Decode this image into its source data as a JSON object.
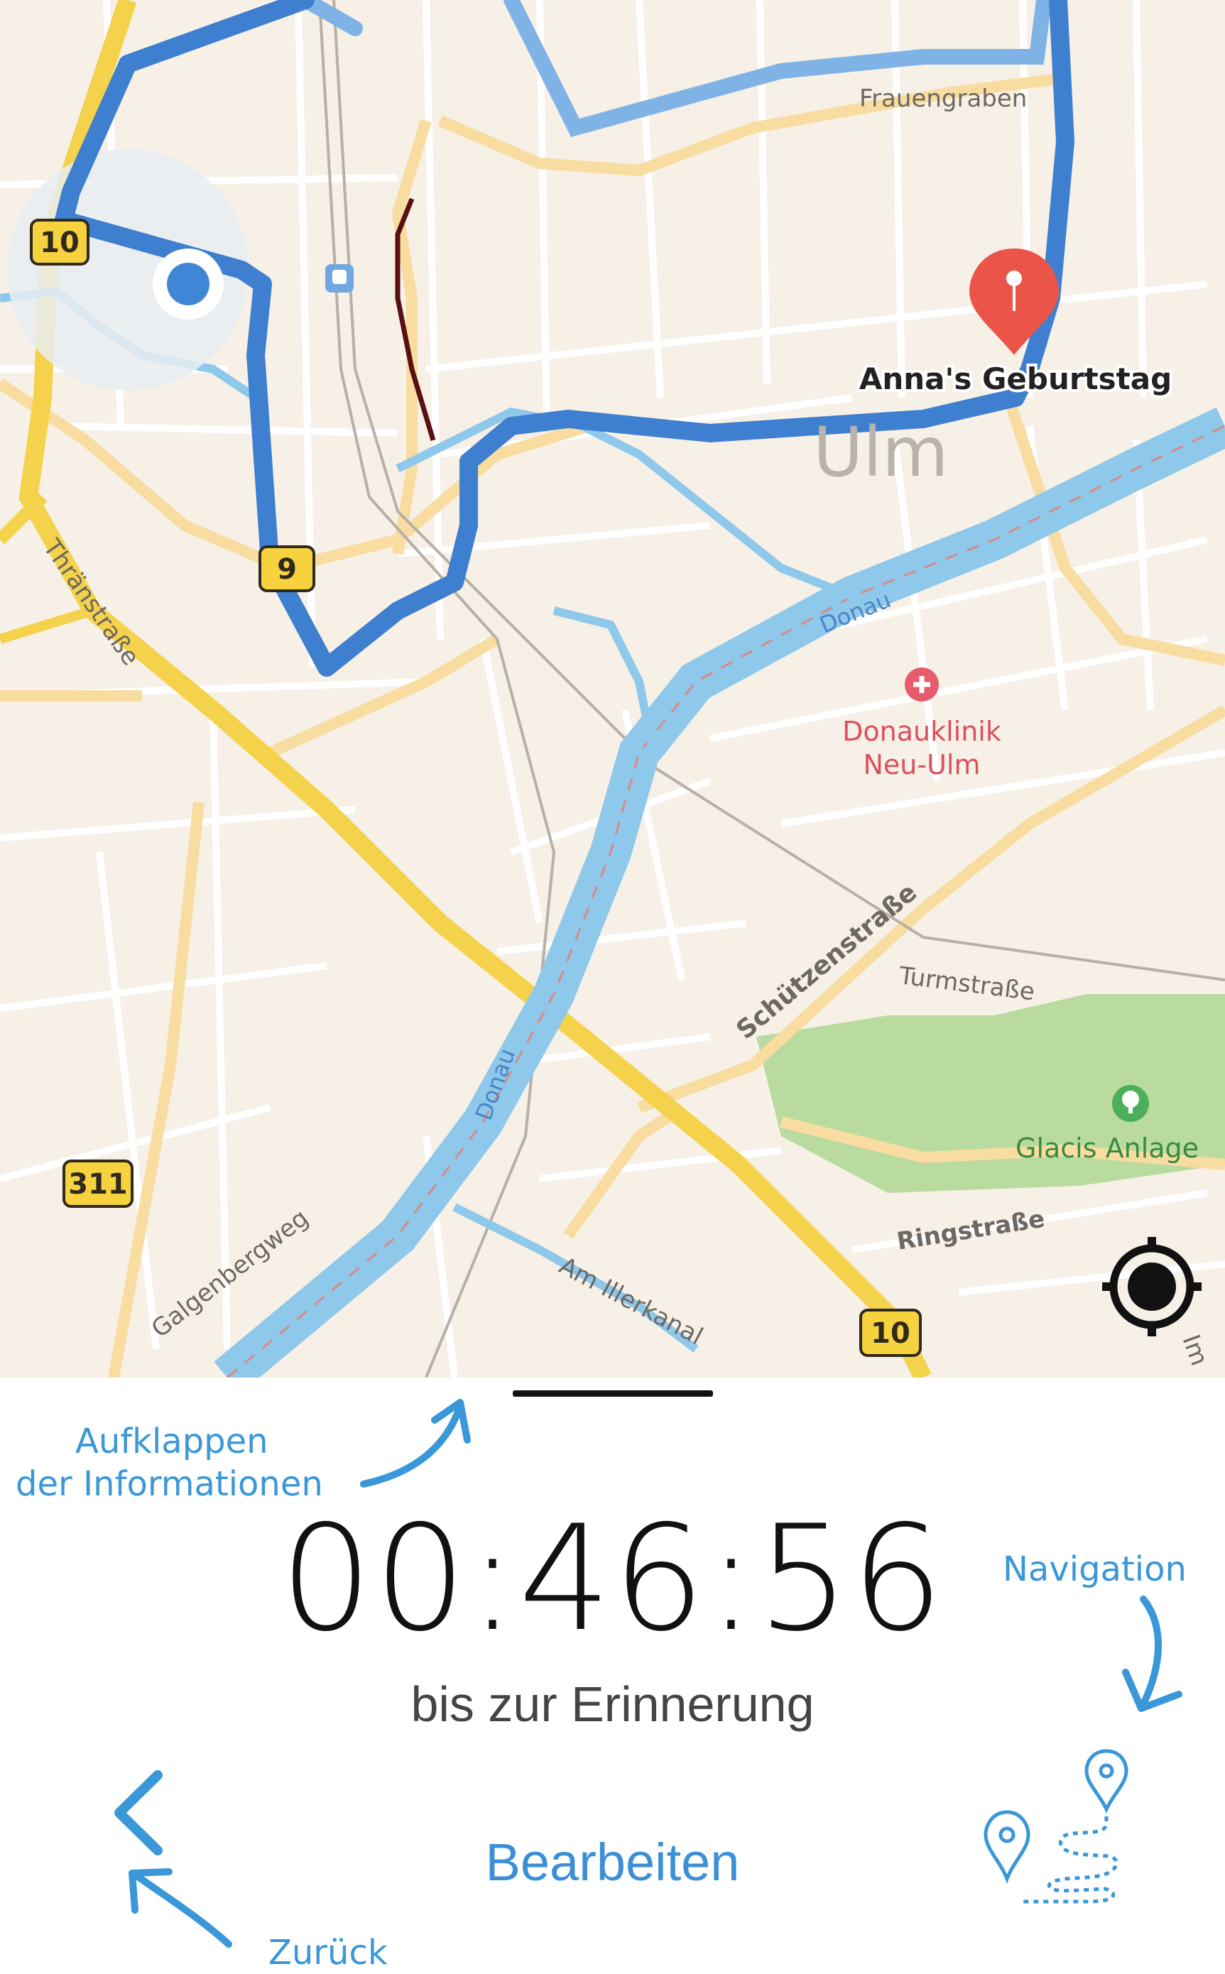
{
  "map": {
    "city_label": "Ulm",
    "destination_label": "Anna's Geburtstag",
    "poi_hospital": "Donauklinik\nNeu-Ulm",
    "poi_hospital_line1": "Donauklinik",
    "poi_hospital_line2": "Neu-Ulm",
    "poi_park": "Glacis Anlage",
    "streets": {
      "frauengraben": "Frauengraben",
      "thraenstrasse": "Thränstraße",
      "schuetzenstrasse": "Schützenstraße",
      "turmstrasse": "Turmstraße",
      "ringstrasse": "Ringstraße",
      "galgenbergweg": "Galgenbergweg",
      "am_illerkanal": "Am Illerkanal",
      "donau_1": "Donau",
      "donau_2": "Donau",
      "edge_fragment": "Im"
    },
    "road_shields": [
      "10",
      "9",
      "311",
      "10"
    ],
    "colors": {
      "route": "#3f7fcf",
      "route_faded": "#7fb3e6",
      "water": "#8ec8ea",
      "major_road": "#f5d24b",
      "park": "#b9dba0",
      "destination_pin": "#ea5449",
      "user_location": "#3f86d6"
    },
    "icons": [
      "user-location-icon",
      "destination-pin-icon",
      "hospital-icon",
      "park-icon",
      "train-station-icon",
      "recenter-location-icon"
    ]
  },
  "bottom_sheet": {
    "countdown": "00:46:56",
    "countdown_label": "bis zur Erinnerung",
    "edit_button": "Bearbeiten",
    "icons": [
      "back-chevron-icon",
      "navigation-route-icon"
    ]
  },
  "annotations": {
    "expand_line1": "Aufklappen",
    "expand_line2": "der Informationen",
    "navigation": "Navigation",
    "back": "Zurück",
    "color": "#3a97d8"
  }
}
